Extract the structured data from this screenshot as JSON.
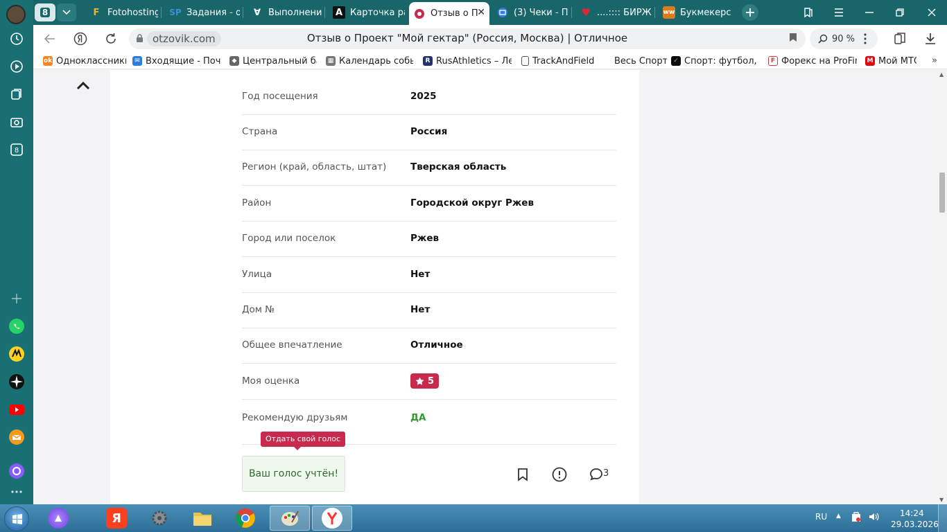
{
  "tabs": {
    "count": "8",
    "items": [
      {
        "label": "Fotohosting",
        "icon": "F",
        "icon_color": "#f2b233"
      },
      {
        "label": "Задания - of",
        "icon": "SP",
        "icon_color": "#3a8fd9"
      },
      {
        "label": "Выполнени",
        "icon": "∀",
        "icon_color": "#ffffff"
      },
      {
        "label": "Карточка ра",
        "icon": "A",
        "icon_color": "#111111"
      },
      {
        "label": "Отзыв о П",
        "icon": "◉",
        "icon_color": "#c8294c"
      },
      {
        "label": "(3) Чеки - П",
        "icon": "✉",
        "icon_color": "#2f7de1"
      },
      {
        "label": "....:::: БИРЖА",
        "icon": "♥",
        "icon_color": "#e0262e"
      },
      {
        "label": "Букмекерск",
        "icon": "ww",
        "icon_color": "#e07b1c"
      }
    ]
  },
  "address": {
    "domain": "otzovik.com",
    "title": "Отзыв о Проект \"Мой гектар\" (Россия, Москва) | Отличное",
    "zoom": "90 %"
  },
  "bookmarks": [
    {
      "label": "Одноклассники",
      "color": "#f5861f",
      "icon": "ok"
    },
    {
      "label": "Входящие - Почта",
      "color": "#2f7de1",
      "icon": "✉"
    },
    {
      "label": "Центральный бан",
      "color": "#666666",
      "icon": "◆"
    },
    {
      "label": "Календарь событ",
      "color": "#777777",
      "icon": "▦"
    },
    {
      "label": "RusAthletics – Ле",
      "color": "#23336e",
      "icon": "R"
    },
    {
      "label": "TrackAndField",
      "color": "#ffffff",
      "icon": "▯"
    },
    {
      "label": "Весь Спорт",
      "color": "#ffffff",
      "icon": ""
    },
    {
      "label": "Спорт: футбол, хо",
      "color": "#0b0b0b",
      "icon": "✓"
    },
    {
      "label": "Форекс на ProFina",
      "color": "#d23a3a",
      "icon": "F"
    },
    {
      "label": "Мой МТС",
      "color": "#e30611",
      "icon": "M"
    }
  ],
  "review": {
    "rows": [
      {
        "label": "Год посещения",
        "value": "2025"
      },
      {
        "label": "Страна",
        "value": "Россия"
      },
      {
        "label": "Регион (край, область, штат)",
        "value": "Тверская область"
      },
      {
        "label": "Район",
        "value": "Городской округ Ржев"
      },
      {
        "label": "Город или поселок",
        "value": "Ржев"
      },
      {
        "label": "Улица",
        "value": "Нет"
      },
      {
        "label": "Дом №",
        "value": "Нет"
      },
      {
        "label": "Общее впечатление",
        "value": "Отличное"
      }
    ],
    "rating_label": "Моя оценка",
    "rating_value": "5",
    "recommend_label": "Рекомендую друзьям",
    "recommend_value": "ДА",
    "tooltip": "Отдать свой голос",
    "vote_text": "Ваш голос учтён!",
    "comment_count": "3"
  },
  "taskbar": {
    "lang": "RU",
    "time": "14:24",
    "date": "29.03.2026"
  },
  "colors": {
    "sidebar": "#1a6f73",
    "tabbar": "#19666a",
    "accent": "#c8294c",
    "recommend": "#2f9a2f"
  }
}
